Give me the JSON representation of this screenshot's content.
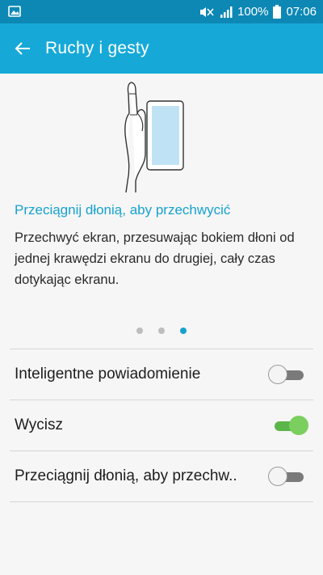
{
  "status_bar": {
    "battery_percent": "100%",
    "time": "07:06",
    "icons": [
      "gallery-icon",
      "mute-icon",
      "signal-icon",
      "battery-icon"
    ]
  },
  "app_bar": {
    "title": "Ruchy i gesty",
    "back_icon": "back-arrow-icon"
  },
  "feature": {
    "illustration": "palm-swipe-illustration",
    "title": "Przeciągnij dłonią, aby przechwycić",
    "description": "Przechwyć ekran, przesuwając bokiem dłoni od jednej krawędzi ekranu do drugiej, cały czas dotykając ekranu."
  },
  "pager": {
    "total": 3,
    "active_index": 2
  },
  "settings": [
    {
      "label": "Inteligentne powiadomienie",
      "enabled": false
    },
    {
      "label": "Wycisz",
      "enabled": true
    },
    {
      "label": "Przeciągnij dłonią, aby przechw..",
      "enabled": false
    }
  ],
  "colors": {
    "status_bar": "#0d88b5",
    "app_bar": "#16a9d8",
    "accent": "#16a2cf",
    "toggle_on": "#7bcf5e",
    "background": "#f6f6f6"
  }
}
